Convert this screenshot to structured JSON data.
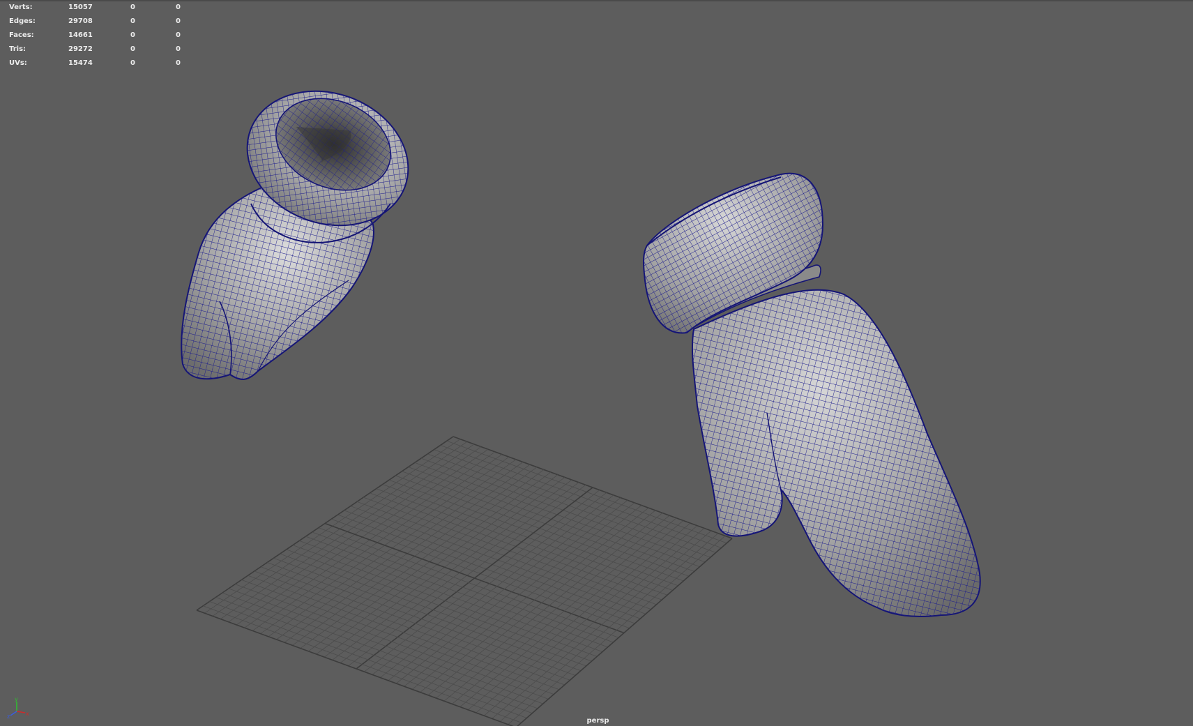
{
  "hud": {
    "rows": [
      {
        "label": "Verts:",
        "c1": "15057",
        "c2": "0",
        "c3": "0"
      },
      {
        "label": "Edges:",
        "c1": "29708",
        "c2": "0",
        "c3": "0"
      },
      {
        "label": "Faces:",
        "c1": "14661",
        "c2": "0",
        "c3": "0"
      },
      {
        "label": "Tris:",
        "c1": "29272",
        "c2": "0",
        "c3": "0"
      },
      {
        "label": "UVs:",
        "c1": "15474",
        "c2": "0",
        "c3": "0"
      }
    ]
  },
  "camera": "persp",
  "axis": {
    "y": "y",
    "x": "x",
    "z": "z"
  },
  "colors": {
    "background": "#5d5d5d",
    "wireframe": "#1c1c8c",
    "mesh_shade": "#a4a4a4",
    "grid_line": "#4c4c4c",
    "axis_x": "#d02a2a",
    "axis_y": "#2fc02f",
    "axis_z": "#3a5de0"
  }
}
